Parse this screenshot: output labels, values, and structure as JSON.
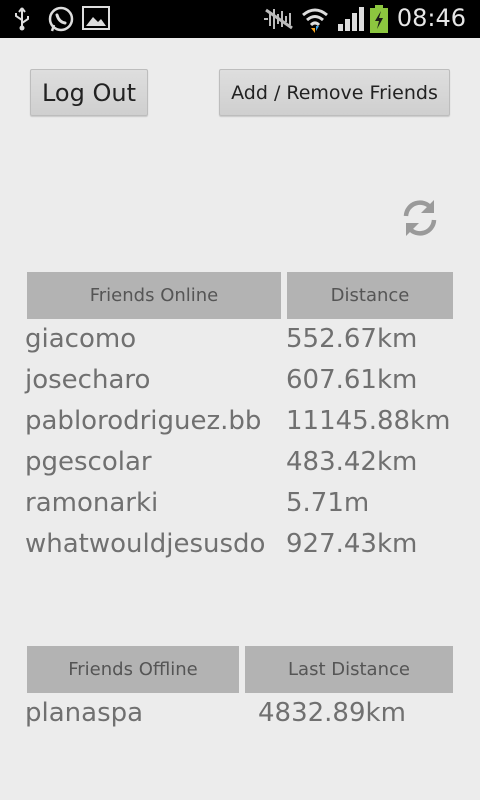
{
  "status_bar": {
    "time": "08:46",
    "icons": [
      "usb-icon",
      "whatsapp-icon",
      "gallery-icon",
      "mute-icon",
      "wifi-icon",
      "signal-icon",
      "battery-charging-icon"
    ]
  },
  "toolbar": {
    "logout_label": "Log Out",
    "manage_friends_label": "Add / Remove Friends"
  },
  "online": {
    "header_name": "Friends Online",
    "header_distance": "Distance",
    "rows": [
      {
        "name": "giacomo",
        "distance": "552.67km"
      },
      {
        "name": "josecharo",
        "distance": "607.61km"
      },
      {
        "name": "pablorodriguez.bb",
        "distance": "11145.88km"
      },
      {
        "name": "pgescolar",
        "distance": "483.42km"
      },
      {
        "name": "ramonarki",
        "distance": "5.71m"
      },
      {
        "name": "whatwouldjesusdo",
        "distance": "927.43km"
      }
    ]
  },
  "offline": {
    "header_name": "Friends Offline",
    "header_distance": "Last Distance",
    "rows": [
      {
        "name": "planaspa",
        "distance": "4832.89km"
      }
    ]
  },
  "colors": {
    "background": "#ececec",
    "header_bg": "#b3b3b3",
    "row_text": "#707070",
    "status_bar": "#000000",
    "battery_accent": "#8cc63f"
  }
}
